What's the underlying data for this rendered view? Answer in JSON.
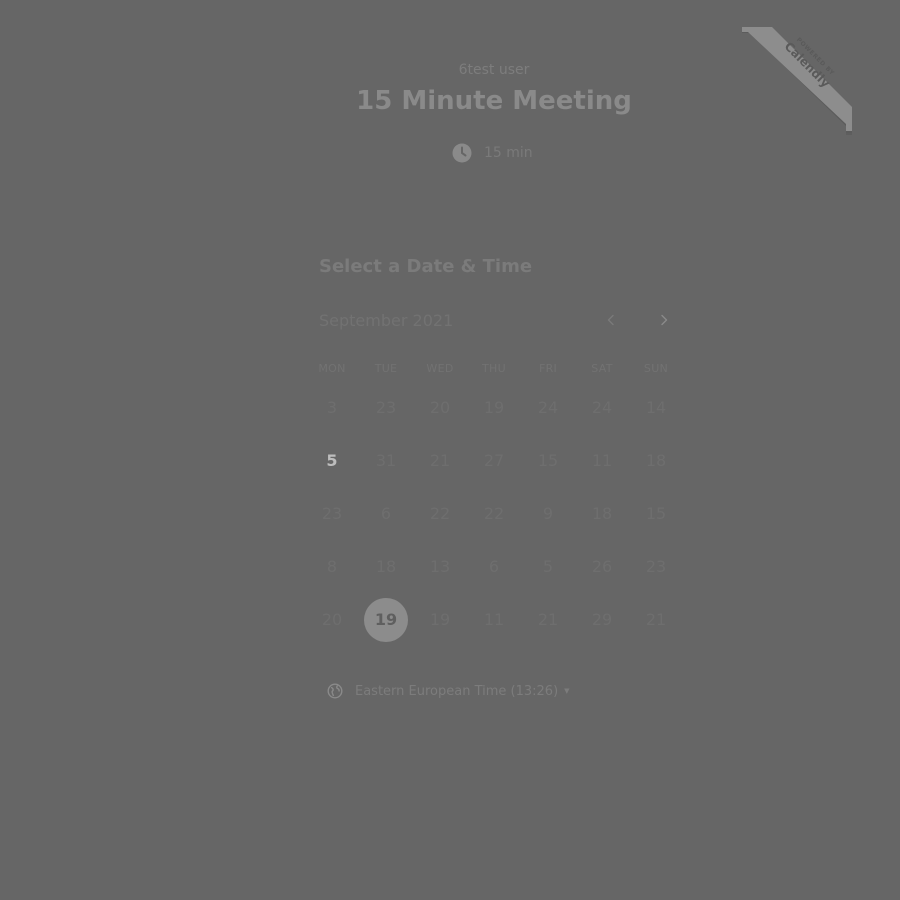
{
  "badge": {
    "powered_by": "POWERED BY",
    "brand": "Calendly"
  },
  "header": {
    "organizer": "6test user",
    "title": "15 Minute Meeting",
    "duration": "15 min",
    "duration_icon": "clock-icon"
  },
  "scheduler": {
    "section_title": "Select a Date & Time",
    "month": "September 2021",
    "prev_icon": "chevron-left-icon",
    "next_icon": "chevron-right-icon",
    "weekdays": [
      "MON",
      "TUE",
      "WED",
      "THU",
      "FRI",
      "SAT",
      "SUN"
    ],
    "weeks": [
      [
        "3",
        "23",
        "20",
        "19",
        "24",
        "24",
        "14"
      ],
      [
        "5",
        "31",
        "21",
        "27",
        "15",
        "11",
        "18"
      ],
      [
        "23",
        "6",
        "22",
        "22",
        "9",
        "18",
        "15"
      ],
      [
        "8",
        "18",
        "13",
        "6",
        "5",
        "26",
        "23"
      ],
      [
        "20",
        "19",
        "19",
        "11",
        "21",
        "29",
        "21"
      ]
    ],
    "today": "5",
    "selected": "19"
  },
  "timezone": {
    "icon": "globe-icon",
    "label": "Eastern European Time (13:26)",
    "caret": "caret-down-icon"
  },
  "colors": {
    "background": "#666666",
    "selected_circle": "#8c8c8c",
    "badge": "#8a8a8a"
  }
}
